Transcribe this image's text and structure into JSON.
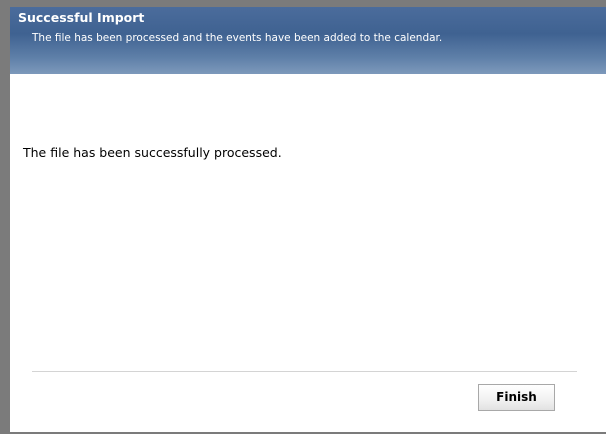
{
  "header": {
    "title": "Successful Import",
    "subtitle": "The file has been processed and the events have been added to the calendar."
  },
  "main": {
    "message": "The file has been successfully processed."
  },
  "footer": {
    "finish_label": "Finish"
  },
  "colors": {
    "header_accent": "#3f6291",
    "frame": "#7b7b7b"
  }
}
